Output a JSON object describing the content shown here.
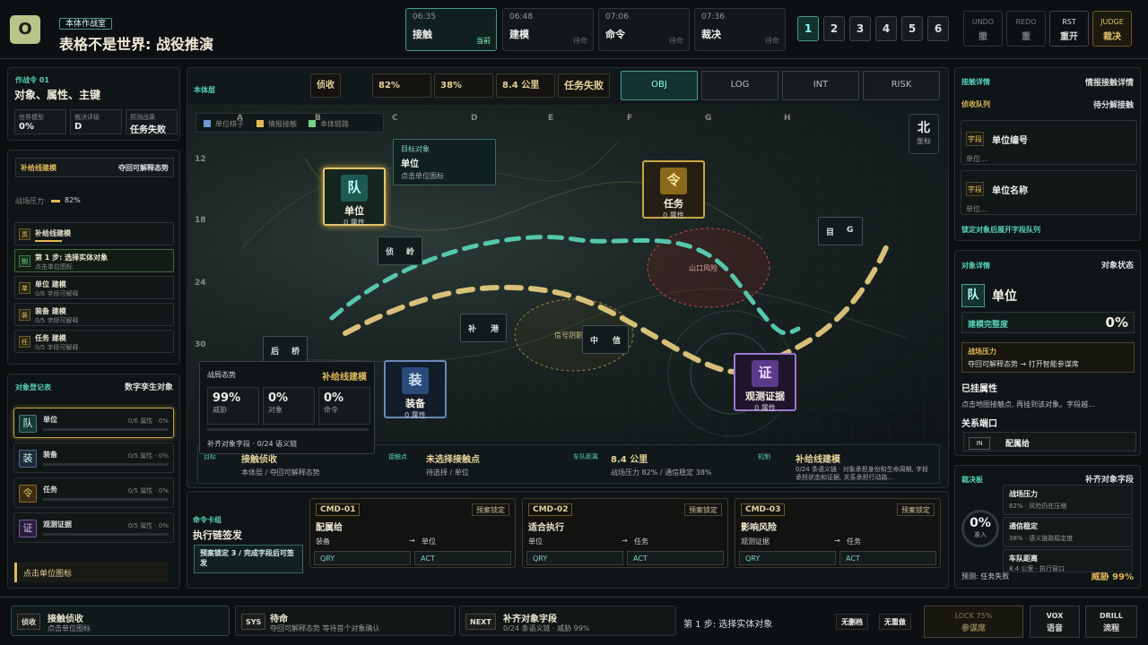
{
  "header": {
    "logo": "O",
    "tag": "本体作战室",
    "title": "表格不是世界: 战役推演",
    "phases": [
      {
        "time": "06:35",
        "name": "接触",
        "status": "当前"
      },
      {
        "time": "06:48",
        "name": "建模",
        "status": "待命"
      },
      {
        "time": "07:06",
        "name": "命令",
        "status": "待命"
      },
      {
        "time": "07:36",
        "name": "裁决",
        "status": "待命"
      }
    ],
    "steps": [
      "1",
      "2",
      "3",
      "4",
      "5",
      "6"
    ],
    "buttons": [
      {
        "top": "UNDO",
        "bottom": "撤"
      },
      {
        "top": "REDO",
        "bottom": "重"
      },
      {
        "top": "RST",
        "bottom": "重开"
      },
      {
        "top": "JUDGE",
        "bottom": "裁决"
      }
    ]
  },
  "left": {
    "op_code": "作战令 01",
    "op_title": "对象、属性、主键",
    "stats": [
      {
        "label": "世界模型",
        "value": "0%"
      },
      {
        "label": "裁决评级",
        "value": "D"
      },
      {
        "label": "预测战果",
        "value": "任务失败"
      }
    ],
    "chain_tag": "补给线建模",
    "chain_note": "夺回可解释态势",
    "pressure_label": "战场压力",
    "pressure_value": "82%",
    "steps": [
      {
        "icon": "贯",
        "title": "补给线建模",
        "sub": ""
      },
      {
        "icon": "别",
        "title": "第 1 步: 选择实体对象",
        "sub": "点击单位图标"
      },
      {
        "icon": "单",
        "title": "单位 建模",
        "sub": "0/6 字段可解释"
      },
      {
        "icon": "装",
        "title": "装备 建模",
        "sub": "0/5 字段可解释"
      },
      {
        "icon": "任",
        "title": "任务 建模",
        "sub": "0/5 字段可解释"
      }
    ],
    "registry_title": "对象登记表",
    "registry_note": "数字孪生对象",
    "registry": [
      {
        "icon": "队",
        "name": "单位",
        "count": "0/6 属性 · 0%"
      },
      {
        "icon": "装",
        "name": "装备",
        "count": "0/5 属性 · 0%"
      },
      {
        "icon": "令",
        "name": "任务",
        "count": "0/5 属性 · 0%"
      },
      {
        "icon": "证",
        "name": "观测证据",
        "count": "0/5 属性 · 0%"
      }
    ],
    "hint": "点击单位图标"
  },
  "toolbar": {
    "layer": "本体层",
    "chips": [
      "侦收",
      "82%",
      "38%",
      "8.4 公里",
      "任务失败"
    ],
    "tabs": [
      "OBJ",
      "LOG",
      "INT",
      "RISK"
    ]
  },
  "map": {
    "legend": [
      "单位棋子",
      "情报接触",
      "本体链路"
    ],
    "cols": [
      "A",
      "B",
      "C",
      "D",
      "E",
      "F",
      "G",
      "H"
    ],
    "rows": [
      "12",
      "18",
      "24",
      "30"
    ],
    "compass": "北",
    "compass_sub": "坐标",
    "target_title": "目标对象",
    "target_name": "单位",
    "target_sub": "点击单位图标",
    "zone_red": "山口风险",
    "zone_yellow": "信号阴影",
    "units": [
      {
        "icon": "队",
        "name": "单位",
        "sub": "0 属性"
      },
      {
        "icon": "令",
        "name": "任务",
        "sub": "0 属性"
      },
      {
        "icon": "装",
        "name": "装备",
        "sub": "0 属性"
      },
      {
        "icon": "证",
        "name": "观测证据",
        "sub": "0 属性"
      }
    ],
    "markers": [
      {
        "a": "侦",
        "b": "岭"
      },
      {
        "a": "目",
        "b": "G"
      },
      {
        "a": "补",
        "b": "港"
      },
      {
        "a": "中",
        "b": "信"
      },
      {
        "a": "后",
        "b": "桥"
      }
    ],
    "situation": {
      "title": "战局态势",
      "tag": "补给线建模",
      "metrics": [
        {
          "value": "99%",
          "label": "威胁"
        },
        {
          "value": "0%",
          "label": "对象"
        },
        {
          "value": "0%",
          "label": "命令"
        }
      ],
      "footer": "补齐对象字段 · 0/24 语义链"
    },
    "strip": [
      {
        "k": "目标",
        "v": "接触侦收",
        "s": "本体层 / 夺回可解释态势"
      },
      {
        "k": "接触点",
        "v": "未选择接触点",
        "s": "待选择 / 单位"
      },
      {
        "k": "车队距离",
        "v": "8.4 公里",
        "s": "战场压力 82% / 通信稳定 38%"
      },
      {
        "k": "机制",
        "v": "补给线建模",
        "s": "0/24 条语义链 · 对象承担身份和生命周期, 字段承担状态和证据, 关系承担行动路..."
      }
    ]
  },
  "orders": {
    "title": "命令卡组",
    "subtitle": "执行链签发",
    "note": "预案锁定 3 / 完成字段后可签发",
    "cards": [
      {
        "id": "CMD-01",
        "lock": "预案锁定",
        "name": "配属给",
        "from": "装备",
        "to": "单位",
        "q1": "QRY",
        "q2": "ACT"
      },
      {
        "id": "CMD-02",
        "lock": "预案锁定",
        "name": "适合执行",
        "from": "单位",
        "to": "任务",
        "q1": "QRY",
        "q2": "ACT"
      },
      {
        "id": "CMD-03",
        "lock": "预案锁定",
        "name": "影响风险",
        "from": "观测证据",
        "to": "任务",
        "q1": "QRY",
        "q2": "ACT"
      }
    ]
  },
  "right": {
    "intel_title": "接触详情",
    "intel_title2": "情报接触详情",
    "queue_title": "侦收队列",
    "queue_note": "待分解接触",
    "fields": [
      {
        "k": "字段",
        "name": "单位编号",
        "sub": "单位..."
      },
      {
        "k": "字段",
        "name": "单位名称",
        "sub": "单位..."
      }
    ],
    "queue_hint": "锁定对象后展开字段队列",
    "obj_title": "对象详情",
    "obj_state": "对象状态",
    "obj_icon": "队",
    "obj_name": "单位",
    "complete_label": "建模完整度",
    "complete_value": "0%",
    "pressure_title": "战场压力",
    "pressure_sub": "夺回可解释态势 → 打开智能参谋席",
    "attr_title": "已挂属性",
    "attr_sub": "点击地图接触点, 再挂到该对象。字段越...",
    "port_title": "关系端口",
    "port_tag": "IN",
    "port_name": "配属给",
    "judge_title": "裁决板",
    "judge_note": "补齐对象字段",
    "ring_value": "0%",
    "ring_label": "准入",
    "judge_items": [
      {
        "a": "战场压力",
        "b": "82% · 风险仍在压缩"
      },
      {
        "a": "通信稳定",
        "b": "38% · 语义链路稳定度"
      },
      {
        "a": "车队距离",
        "b": "8.4 公里 · 执行窗口"
      }
    ],
    "forecast": "预测: 任务失败",
    "threat": "威胁 99%"
  },
  "bottom": {
    "items": [
      {
        "k": "侦收",
        "a": "接触侦收",
        "b": "点击单位图标"
      },
      {
        "k": "SYS",
        "a": "待命",
        "b": "夺回可解释态势 等待首个对象确认"
      },
      {
        "k": "NEXT",
        "a": "补齐对象字段",
        "b": "0/24 条语义链 · 威胁 99%"
      }
    ],
    "step_text": "第 1 步: 选择实体对象",
    "pill1": "无删档",
    "pill2": "无重做",
    "buttons": [
      {
        "top": "LOCK 75%",
        "bottom": "参谋席"
      },
      {
        "top": "VOX",
        "bottom": "语音"
      },
      {
        "top": "DRILL",
        "bottom": "流程"
      }
    ]
  },
  "colors": {
    "accent": "#55d1b8",
    "gold": "#e2b85a",
    "danger": "#e06565",
    "bg": "#0b0f10"
  }
}
